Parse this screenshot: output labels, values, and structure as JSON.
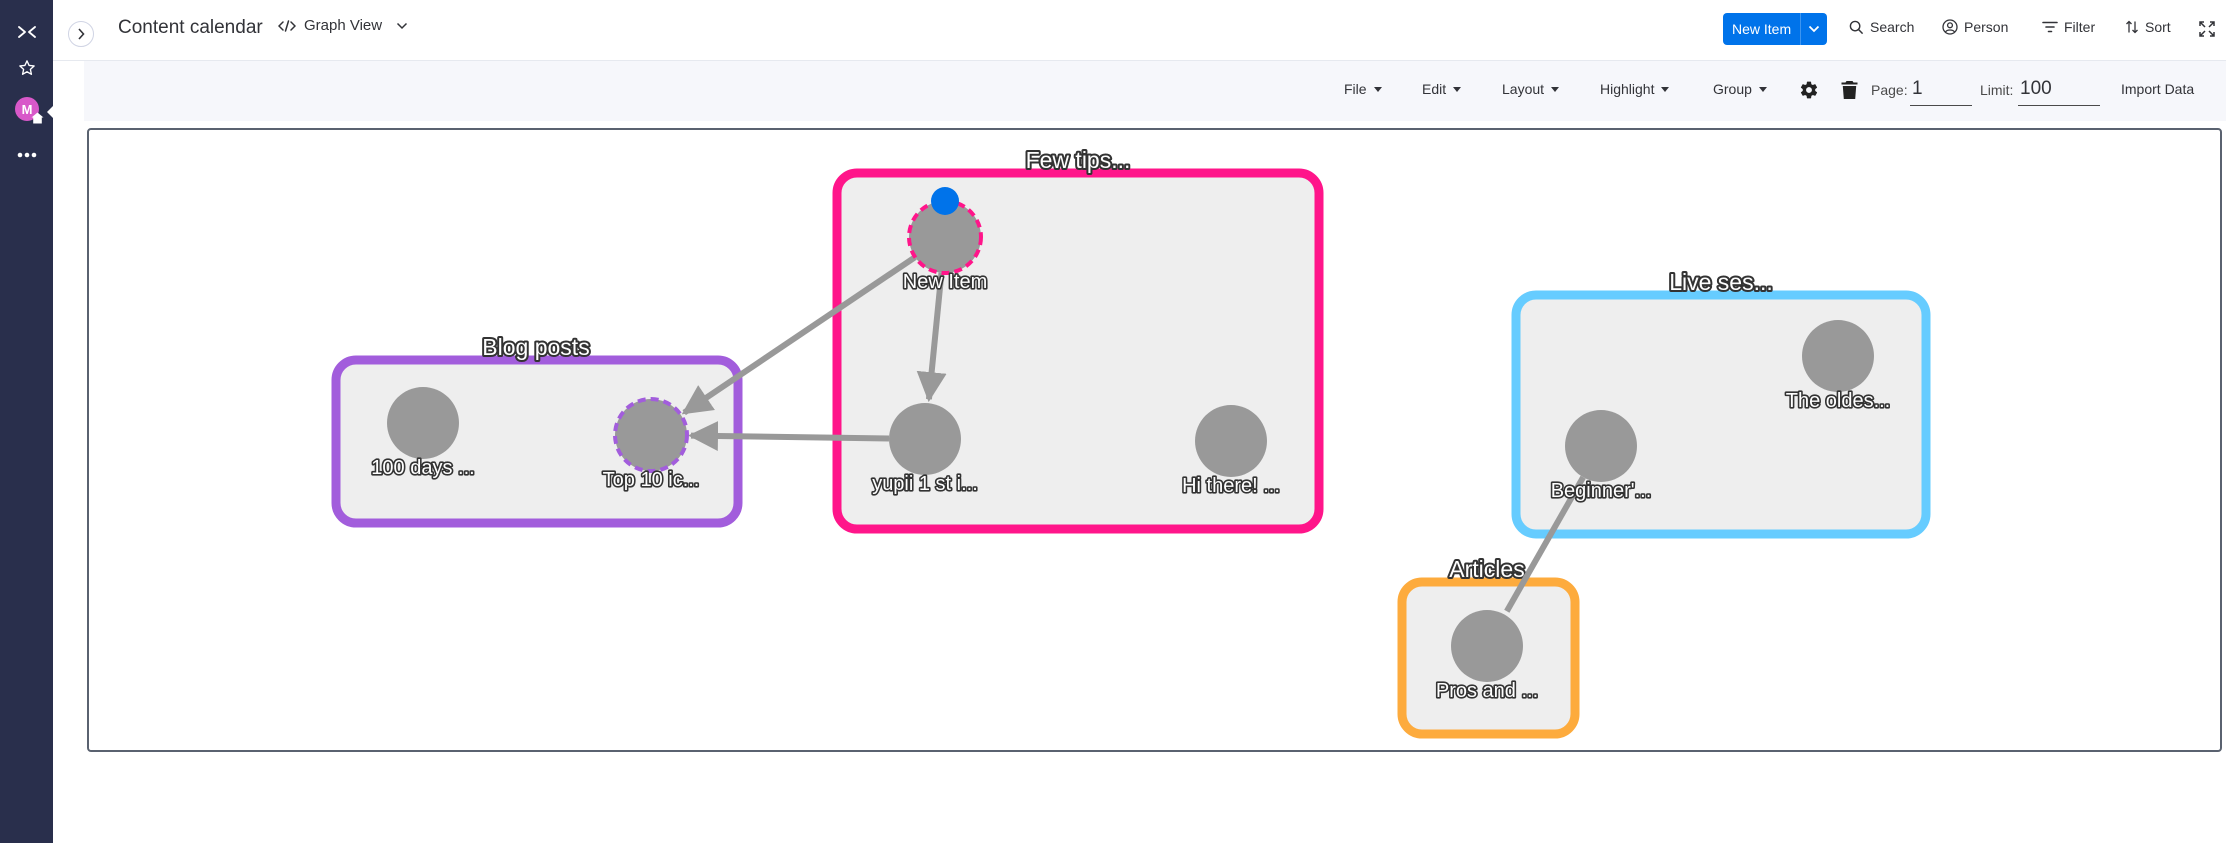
{
  "rail": {
    "avatar_letter": "M",
    "icons": [
      "switcher-icon",
      "star-icon",
      "home-icon",
      "more-icon"
    ]
  },
  "header": {
    "board_title": "Content calendar",
    "view_label": "Graph View",
    "new_item_label": "New Item",
    "search_label": "Search",
    "person_label": "Person",
    "filter_label": "Filter",
    "sort_label": "Sort"
  },
  "toolbar": {
    "menus": [
      "File",
      "Edit",
      "Layout",
      "Highlight",
      "Group"
    ],
    "page_label": "Page:",
    "page_value": "1",
    "limit_label": "Limit:",
    "limit_value": "100",
    "import_label": "Import Data"
  },
  "graph": {
    "groups": [
      {
        "id": "blog",
        "label": "Blog posts",
        "color": "#a25ddc"
      },
      {
        "id": "tips",
        "label": "Few tips...",
        "color": "#ff158a"
      },
      {
        "id": "live",
        "label": "Live ses...",
        "color": "#66ccff"
      },
      {
        "id": "articles",
        "label": "Articles",
        "color": "#fdab3d"
      }
    ],
    "nodes": [
      {
        "id": "n1",
        "label": "100 days ...",
        "group": "blog"
      },
      {
        "id": "n2",
        "label": "Top 10 ic...",
        "group": "blog",
        "selected": true
      },
      {
        "id": "n3",
        "label": "New Item",
        "group": "tips",
        "selected": true,
        "handle": true
      },
      {
        "id": "n4",
        "label": "yupii 1 st i...",
        "group": "tips"
      },
      {
        "id": "n5",
        "label": "Hi there! ...",
        "group": "tips"
      },
      {
        "id": "n6",
        "label": "The oldes...",
        "group": "live"
      },
      {
        "id": "n7",
        "label": "Beginner'...",
        "group": "live"
      },
      {
        "id": "n8",
        "label": "Pros and ...",
        "group": "articles"
      }
    ],
    "edges": [
      {
        "from": "n3",
        "to": "n2",
        "arrow": true
      },
      {
        "from": "n3",
        "to": "n4",
        "arrow": true
      },
      {
        "from": "n4",
        "to": "n2",
        "arrow": true
      },
      {
        "from": "n7",
        "to": "n8",
        "arrow": false
      }
    ],
    "colors": {
      "node": "#999999",
      "edge": "#999999",
      "group_fill": "#eeeeee",
      "handle": "#0073ea"
    }
  }
}
